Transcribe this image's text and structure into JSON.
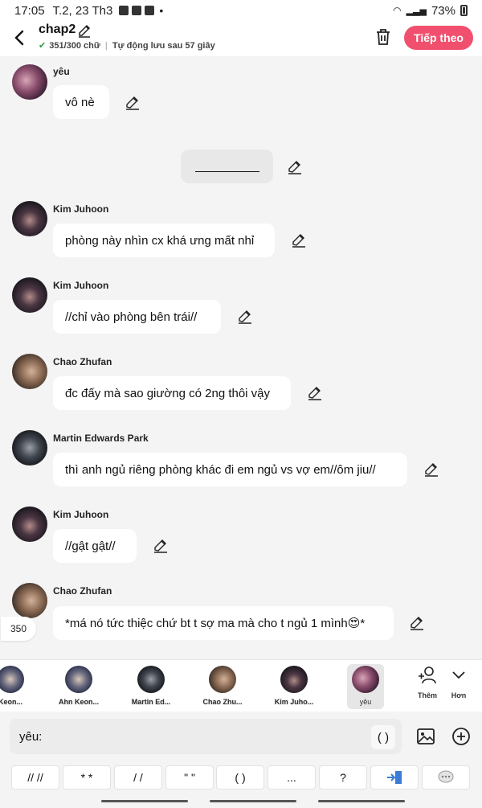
{
  "status_bar": {
    "time": "17:05",
    "date": "T.2, 23 Th3",
    "dot": "•",
    "battery": "73%"
  },
  "header": {
    "title": "chap2",
    "char_count": "351/300 chữ",
    "autosave": "Tự động lưu sau 57 giây",
    "next_label": "Tiếp theo"
  },
  "messages": [
    {
      "name": "yêu",
      "text": "vô nè"
    },
    {
      "name": "Kim Juhoon",
      "text": "phòng này nhìn cx khá ưng mất nhỉ"
    },
    {
      "name": "Kim Juhoon",
      "text": "//chỉ vào phòng bên trái//"
    },
    {
      "name": "Chao Zhufan",
      "text": "đc đấy mà sao giường có 2ng thôi vậy"
    },
    {
      "name": "Martin Edwards Park",
      "text": "thì anh ngủ riêng phòng khác đi em ngủ vs vợ em//ôm jiu//"
    },
    {
      "name": "Kim Juhoon",
      "text": "//gật gật//"
    },
    {
      "name": "Chao Zhufan",
      "text": "*má nó tức thiệc chứ bt t sợ ma mà cho t ngủ 1 mình😍*"
    }
  ],
  "counter": "350",
  "characters": [
    {
      "label": "Keon..."
    },
    {
      "label": "Ahn Keon..."
    },
    {
      "label": "Martin Ed..."
    },
    {
      "label": "Chao Zhu..."
    },
    {
      "label": "Kim Juho..."
    },
    {
      "label": "yêu"
    }
  ],
  "tools": {
    "add_label": "Thêm",
    "more_label": "Hơn"
  },
  "input": {
    "prefix": "yêu:",
    "value": "",
    "paren": "( )"
  },
  "quick_keys": [
    "// //",
    "* *",
    "/ /",
    "\" \"",
    "( )",
    "...",
    "?"
  ],
  "colors": {
    "accent": "#f0506e",
    "bubble": "#ffffff",
    "background": "#f4f4f4"
  }
}
